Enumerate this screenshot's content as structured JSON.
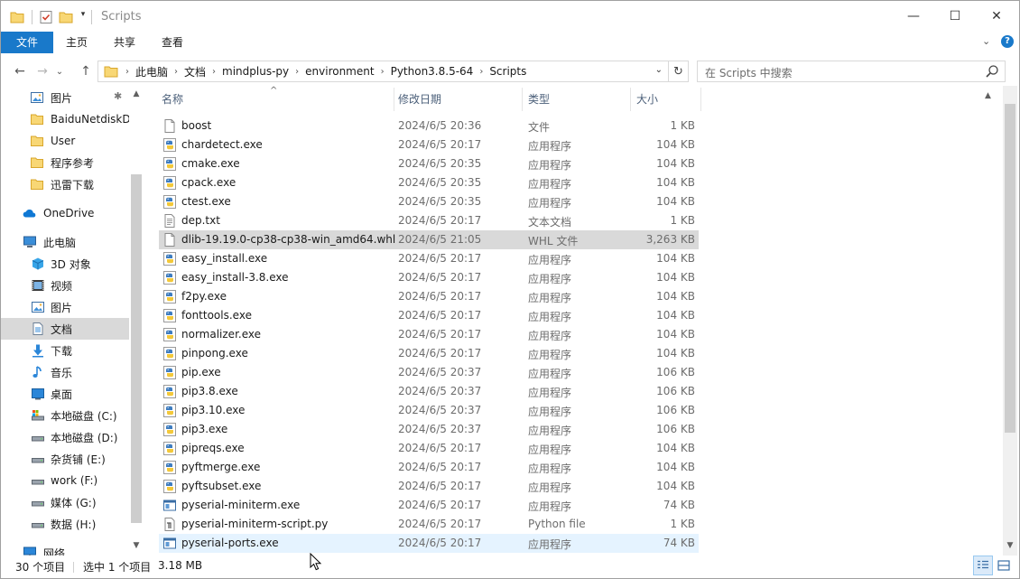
{
  "window": {
    "title": "Scripts",
    "minimize_glyph": "—",
    "maximize_glyph": "☐",
    "close_glyph": "✕"
  },
  "ribbon": {
    "tabs": [
      {
        "label": "文件"
      },
      {
        "label": "主页"
      },
      {
        "label": "共享"
      },
      {
        "label": "查看"
      }
    ],
    "expand_glyph": "⌄",
    "help_glyph": "?"
  },
  "address": {
    "back_glyph": "←",
    "forward_glyph": "→",
    "recent_glyph": "⌄",
    "up_glyph": "↑",
    "crumbs": [
      "此电脑",
      "文档",
      "mindplus-py",
      "environment",
      "Python3.8.5-64",
      "Scripts"
    ],
    "refresh_glyph": "↻"
  },
  "search": {
    "placeholder": "在 Scripts 中搜索"
  },
  "nav": {
    "items": [
      {
        "label": "图片",
        "icon": "pictures-icon",
        "pinned": true
      },
      {
        "label": "BaiduNetdiskD",
        "icon": "folder-icon"
      },
      {
        "label": "User",
        "icon": "folder-icon"
      },
      {
        "label": "程序参考",
        "icon": "folder-icon"
      },
      {
        "label": "迅雷下载",
        "icon": "folder-icon"
      },
      {
        "label": "OneDrive",
        "icon": "onedrive-icon"
      },
      {
        "label": "此电脑",
        "icon": "this-pc-icon"
      },
      {
        "label": "3D 对象",
        "icon": "3d-objects-icon"
      },
      {
        "label": "视频",
        "icon": "videos-icon"
      },
      {
        "label": "图片",
        "icon": "pictures-icon"
      },
      {
        "label": "文档",
        "icon": "documents-icon",
        "selected": true
      },
      {
        "label": "下载",
        "icon": "downloads-icon"
      },
      {
        "label": "音乐",
        "icon": "music-icon"
      },
      {
        "label": "桌面",
        "icon": "desktop-icon"
      },
      {
        "label": "本地磁盘 (C:)",
        "icon": "system-drive-icon"
      },
      {
        "label": "本地磁盘 (D:)",
        "icon": "drive-icon"
      },
      {
        "label": "杂货铺 (E:)",
        "icon": "drive-icon"
      },
      {
        "label": "work (F:)",
        "icon": "drive-icon"
      },
      {
        "label": "媒体 (G:)",
        "icon": "drive-icon"
      },
      {
        "label": "数据 (H:)",
        "icon": "drive-icon"
      },
      {
        "label": "网络",
        "icon": "network-icon"
      }
    ]
  },
  "columns": {
    "name": "名称",
    "date": "修改日期",
    "type": "类型",
    "size": "大小",
    "sort_glyph": "^"
  },
  "files": [
    {
      "name": "boost",
      "date": "2024/6/5 20:36",
      "type": "文件",
      "size": "1 KB",
      "icon": "file-icon"
    },
    {
      "name": "chardetect.exe",
      "date": "2024/6/5 20:17",
      "type": "应用程序",
      "size": "104 KB",
      "icon": "python-exe-icon"
    },
    {
      "name": "cmake.exe",
      "date": "2024/6/5 20:35",
      "type": "应用程序",
      "size": "104 KB",
      "icon": "python-exe-icon"
    },
    {
      "name": "cpack.exe",
      "date": "2024/6/5 20:35",
      "type": "应用程序",
      "size": "104 KB",
      "icon": "python-exe-icon"
    },
    {
      "name": "ctest.exe",
      "date": "2024/6/5 20:35",
      "type": "应用程序",
      "size": "104 KB",
      "icon": "python-exe-icon"
    },
    {
      "name": "dep.txt",
      "date": "2024/6/5 20:17",
      "type": "文本文档",
      "size": "1 KB",
      "icon": "text-file-icon"
    },
    {
      "name": "dlib-19.19.0-cp38-cp38-win_amd64.whl",
      "date": "2024/6/5 21:05",
      "type": "WHL 文件",
      "size": "3,263 KB",
      "icon": "file-icon",
      "selected": true
    },
    {
      "name": "easy_install.exe",
      "date": "2024/6/5 20:17",
      "type": "应用程序",
      "size": "104 KB",
      "icon": "python-exe-icon"
    },
    {
      "name": "easy_install-3.8.exe",
      "date": "2024/6/5 20:17",
      "type": "应用程序",
      "size": "104 KB",
      "icon": "python-exe-icon"
    },
    {
      "name": "f2py.exe",
      "date": "2024/6/5 20:17",
      "type": "应用程序",
      "size": "104 KB",
      "icon": "python-exe-icon"
    },
    {
      "name": "fonttools.exe",
      "date": "2024/6/5 20:17",
      "type": "应用程序",
      "size": "104 KB",
      "icon": "python-exe-icon"
    },
    {
      "name": "normalizer.exe",
      "date": "2024/6/5 20:17",
      "type": "应用程序",
      "size": "104 KB",
      "icon": "python-exe-icon"
    },
    {
      "name": "pinpong.exe",
      "date": "2024/6/5 20:17",
      "type": "应用程序",
      "size": "104 KB",
      "icon": "python-exe-icon"
    },
    {
      "name": "pip.exe",
      "date": "2024/6/5 20:37",
      "type": "应用程序",
      "size": "106 KB",
      "icon": "python-exe-icon"
    },
    {
      "name": "pip3.8.exe",
      "date": "2024/6/5 20:37",
      "type": "应用程序",
      "size": "106 KB",
      "icon": "python-exe-icon"
    },
    {
      "name": "pip3.10.exe",
      "date": "2024/6/5 20:37",
      "type": "应用程序",
      "size": "106 KB",
      "icon": "python-exe-icon"
    },
    {
      "name": "pip3.exe",
      "date": "2024/6/5 20:37",
      "type": "应用程序",
      "size": "106 KB",
      "icon": "python-exe-icon"
    },
    {
      "name": "pipreqs.exe",
      "date": "2024/6/5 20:17",
      "type": "应用程序",
      "size": "104 KB",
      "icon": "python-exe-icon"
    },
    {
      "name": "pyftmerge.exe",
      "date": "2024/6/5 20:17",
      "type": "应用程序",
      "size": "104 KB",
      "icon": "python-exe-icon"
    },
    {
      "name": "pyftsubset.exe",
      "date": "2024/6/5 20:17",
      "type": "应用程序",
      "size": "104 KB",
      "icon": "python-exe-icon"
    },
    {
      "name": "pyserial-miniterm.exe",
      "date": "2024/6/5 20:17",
      "type": "应用程序",
      "size": "74 KB",
      "icon": "app-window-icon"
    },
    {
      "name": "pyserial-miniterm-script.py",
      "date": "2024/6/5 20:17",
      "type": "Python file",
      "size": "1 KB",
      "icon": "python-script-icon"
    },
    {
      "name": "pyserial-ports.exe",
      "date": "2024/6/5 20:17",
      "type": "应用程序",
      "size": "74 KB",
      "icon": "app-window-icon",
      "hover": true
    }
  ],
  "status": {
    "count": "30 个项目",
    "selected": "选中 1 个项目",
    "size": "3.18 MB"
  },
  "colors": {
    "accent": "#1979ca",
    "selection": "#d9d9d9",
    "hover": "#e5f3ff",
    "folder": "#f8d775",
    "header_text": "#4c607a"
  }
}
